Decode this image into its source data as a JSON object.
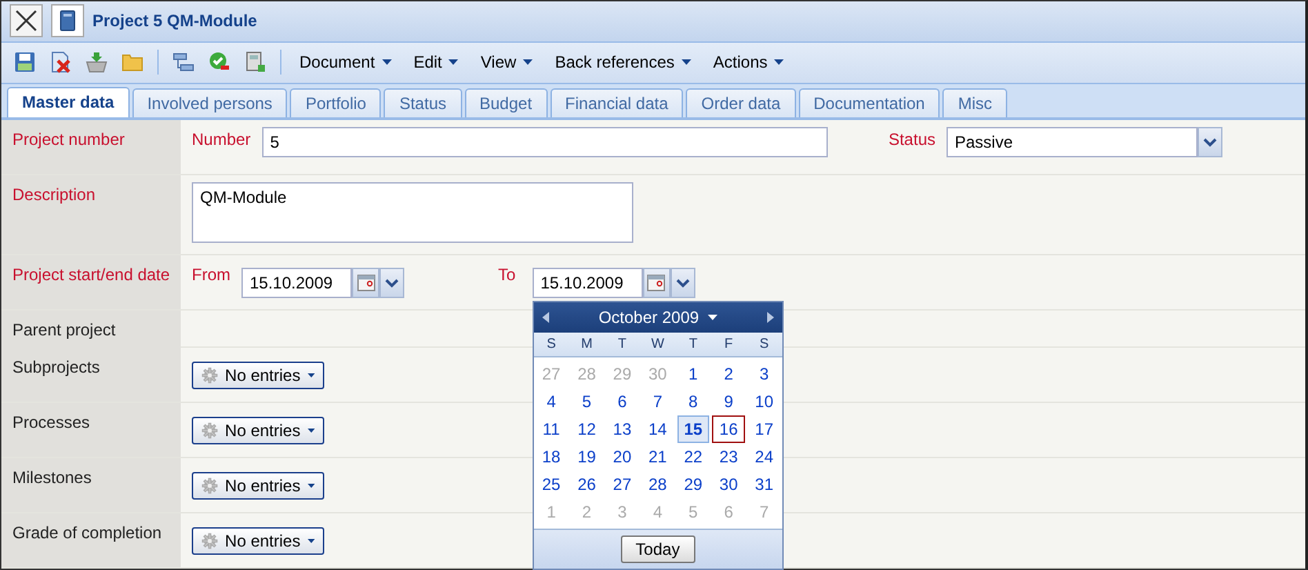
{
  "window": {
    "title": "Project 5 QM-Module"
  },
  "toolbar": {
    "menus": [
      {
        "label": "Document"
      },
      {
        "label": "Edit"
      },
      {
        "label": "View"
      },
      {
        "label": "Back references"
      },
      {
        "label": "Actions"
      }
    ]
  },
  "tabs": [
    {
      "label": "Master data",
      "selected": true
    },
    {
      "label": "Involved persons",
      "selected": false
    },
    {
      "label": "Portfolio",
      "selected": false
    },
    {
      "label": "Status",
      "selected": false
    },
    {
      "label": "Budget",
      "selected": false
    },
    {
      "label": "Financial data",
      "selected": false
    },
    {
      "label": "Order data",
      "selected": false
    },
    {
      "label": "Documentation",
      "selected": false
    },
    {
      "label": "Misc",
      "selected": false
    }
  ],
  "form": {
    "rows": [
      {
        "kind": "number",
        "label": "Project number",
        "required": true,
        "field_label": "Number",
        "value": "5",
        "status_label": "Status",
        "status_value": "Passive"
      },
      {
        "kind": "textarea",
        "label": "Description",
        "required": true,
        "value": "QM-Module"
      },
      {
        "kind": "date_range",
        "label": "Project start/end date",
        "required": true,
        "from_label": "From",
        "from_value": "15.10.2009",
        "to_label": "To",
        "to_value": "15.10.2009"
      },
      {
        "kind": "empty",
        "label": "Parent project",
        "required": false
      },
      {
        "kind": "entries",
        "label": "Subprojects",
        "required": false,
        "button": "No entries"
      },
      {
        "kind": "entries",
        "label": "Processes",
        "required": false,
        "button": "No entries"
      },
      {
        "kind": "entries",
        "label": "Milestones",
        "required": false,
        "button": "No entries"
      },
      {
        "kind": "entries",
        "label": "Grade of completion",
        "required": false,
        "button": "No entries"
      }
    ]
  },
  "calendar": {
    "month": "October 2009",
    "weekdays": [
      "S",
      "M",
      "T",
      "W",
      "T",
      "F",
      "S"
    ],
    "today_button": "Today",
    "days": [
      {
        "label": "27",
        "in_month": false,
        "selected": false,
        "hovered": false
      },
      {
        "label": "28",
        "in_month": false,
        "selected": false,
        "hovered": false
      },
      {
        "label": "29",
        "in_month": false,
        "selected": false,
        "hovered": false
      },
      {
        "label": "30",
        "in_month": false,
        "selected": false,
        "hovered": false
      },
      {
        "label": "1",
        "in_month": true,
        "selected": false,
        "hovered": false
      },
      {
        "label": "2",
        "in_month": true,
        "selected": false,
        "hovered": false
      },
      {
        "label": "3",
        "in_month": true,
        "selected": false,
        "hovered": false
      },
      {
        "label": "4",
        "in_month": true,
        "selected": false,
        "hovered": false
      },
      {
        "label": "5",
        "in_month": true,
        "selected": false,
        "hovered": false
      },
      {
        "label": "6",
        "in_month": true,
        "selected": false,
        "hovered": false
      },
      {
        "label": "7",
        "in_month": true,
        "selected": false,
        "hovered": false
      },
      {
        "label": "8",
        "in_month": true,
        "selected": false,
        "hovered": false
      },
      {
        "label": "9",
        "in_month": true,
        "selected": false,
        "hovered": false
      },
      {
        "label": "10",
        "in_month": true,
        "selected": false,
        "hovered": false
      },
      {
        "label": "11",
        "in_month": true,
        "selected": false,
        "hovered": false
      },
      {
        "label": "12",
        "in_month": true,
        "selected": false,
        "hovered": false
      },
      {
        "label": "13",
        "in_month": true,
        "selected": false,
        "hovered": false
      },
      {
        "label": "14",
        "in_month": true,
        "selected": false,
        "hovered": false
      },
      {
        "label": "15",
        "in_month": true,
        "selected": true,
        "hovered": false
      },
      {
        "label": "16",
        "in_month": true,
        "selected": false,
        "hovered": true
      },
      {
        "label": "17",
        "in_month": true,
        "selected": false,
        "hovered": false
      },
      {
        "label": "18",
        "in_month": true,
        "selected": false,
        "hovered": false
      },
      {
        "label": "19",
        "in_month": true,
        "selected": false,
        "hovered": false
      },
      {
        "label": "20",
        "in_month": true,
        "selected": false,
        "hovered": false
      },
      {
        "label": "21",
        "in_month": true,
        "selected": false,
        "hovered": false
      },
      {
        "label": "22",
        "in_month": true,
        "selected": false,
        "hovered": false
      },
      {
        "label": "23",
        "in_month": true,
        "selected": false,
        "hovered": false
      },
      {
        "label": "24",
        "in_month": true,
        "selected": false,
        "hovered": false
      },
      {
        "label": "25",
        "in_month": true,
        "selected": false,
        "hovered": false
      },
      {
        "label": "26",
        "in_month": true,
        "selected": false,
        "hovered": false
      },
      {
        "label": "27",
        "in_month": true,
        "selected": false,
        "hovered": false
      },
      {
        "label": "28",
        "in_month": true,
        "selected": false,
        "hovered": false
      },
      {
        "label": "29",
        "in_month": true,
        "selected": false,
        "hovered": false
      },
      {
        "label": "30",
        "in_month": true,
        "selected": false,
        "hovered": false
      },
      {
        "label": "31",
        "in_month": true,
        "selected": false,
        "hovered": false
      },
      {
        "label": "1",
        "in_month": false,
        "selected": false,
        "hovered": false
      },
      {
        "label": "2",
        "in_month": false,
        "selected": false,
        "hovered": false
      },
      {
        "label": "3",
        "in_month": false,
        "selected": false,
        "hovered": false
      },
      {
        "label": "4",
        "in_month": false,
        "selected": false,
        "hovered": false
      },
      {
        "label": "5",
        "in_month": false,
        "selected": false,
        "hovered": false
      },
      {
        "label": "6",
        "in_month": false,
        "selected": false,
        "hovered": false
      },
      {
        "label": "7",
        "in_month": false,
        "selected": false,
        "hovered": false
      }
    ]
  }
}
